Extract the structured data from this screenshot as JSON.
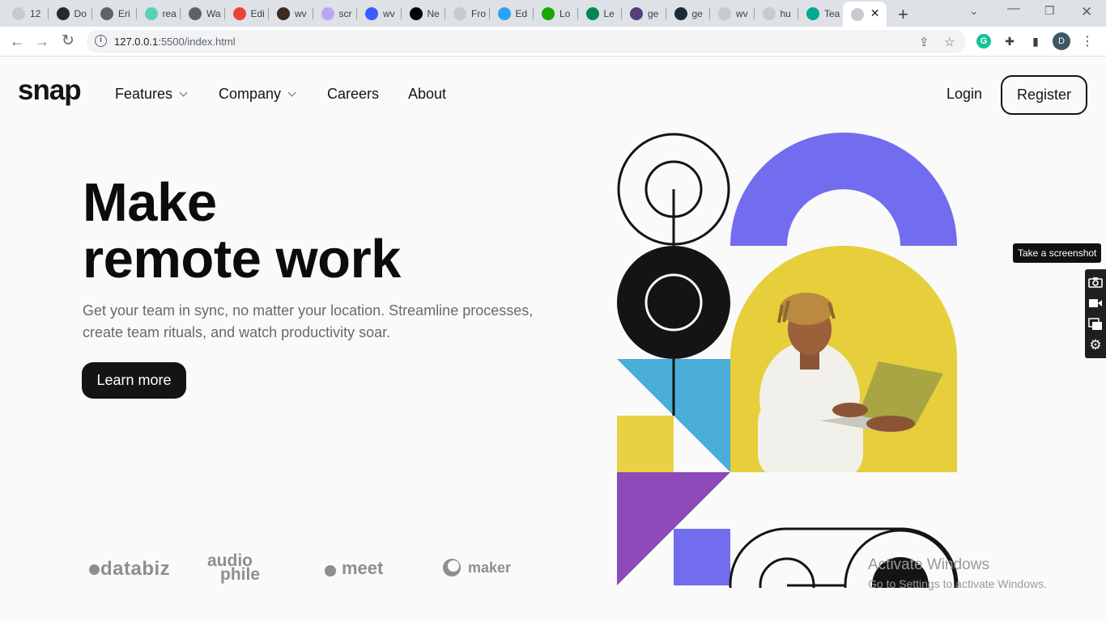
{
  "browser": {
    "tabs": [
      {
        "label": "12",
        "icon": "app-icon",
        "color": "#c6cad1"
      },
      {
        "label": "Do",
        "icon": "github-icon",
        "color": "#24292f"
      },
      {
        "label": "Eri",
        "icon": "globe-icon",
        "color": "#5f6368"
      },
      {
        "label": "rea",
        "icon": "app-icon",
        "color": "#5ad1b6"
      },
      {
        "label": "Wa",
        "icon": "globe-icon",
        "color": "#5f6368"
      },
      {
        "label": "Edi",
        "icon": "gmail-icon",
        "color": "#ea4335"
      },
      {
        "label": "wv",
        "icon": "avatar-icon",
        "color": "#3b2a1e"
      },
      {
        "label": "scr",
        "icon": "app-icon",
        "color": "#b9a6f3"
      },
      {
        "label": "wv",
        "icon": "app-icon",
        "color": "#3d5afe"
      },
      {
        "label": "Ne",
        "icon": "triangle-icon",
        "color": "#000000"
      },
      {
        "label": "Fro",
        "icon": "app-icon",
        "color": "#c6cad1"
      },
      {
        "label": "Ed",
        "icon": "app-icon",
        "color": "#2aa4f4"
      },
      {
        "label": "Lo",
        "icon": "upwork-icon",
        "color": "#14a800"
      },
      {
        "label": "Le",
        "icon": "flag-icon",
        "color": "#008751"
      },
      {
        "label": "ge",
        "icon": "bootstrap-icon",
        "color": "#563d7c"
      },
      {
        "label": "ge",
        "icon": "cursor-icon",
        "color": "#1b2b34"
      },
      {
        "label": "wv",
        "icon": "app-icon",
        "color": "#c6cad1"
      },
      {
        "label": "hu",
        "icon": "app-icon",
        "color": "#c6cad1"
      },
      {
        "label": "Tea",
        "icon": "diamond-icon",
        "color": "#00a98f"
      },
      {
        "label": "",
        "icon": "app-icon",
        "color": "#c6cad1",
        "active": true
      }
    ],
    "url_host": "127.0.0.1",
    "url_path": ":5500/index.html",
    "profile_initial": "D"
  },
  "page": {
    "logo": "snap",
    "nav": {
      "features": "Features",
      "company": "Company",
      "careers": "Careers",
      "about": "About"
    },
    "login": "Login",
    "register": "Register",
    "headline_line1": "Make",
    "headline_line2": "remote work",
    "subtext": "Get your team in sync, no matter your location. Streamline processes, create team rituals, and watch productivity soar.",
    "cta": "Learn more",
    "clients": {
      "databiz": "databiz",
      "audiophile_1": "audio",
      "audiophile_2": "phile",
      "meet": "meet",
      "maker": "maker"
    }
  },
  "overlay": {
    "screenshot_tooltip": "Take a screenshot",
    "activate_title": "Activate Windows",
    "activate_sub": "Go to Settings to activate Windows."
  },
  "colors": {
    "purple": "#726cee",
    "yellow": "#e9d144",
    "blue": "#4aaed9",
    "violet": "#8e4ab8",
    "dark": "#141414"
  }
}
